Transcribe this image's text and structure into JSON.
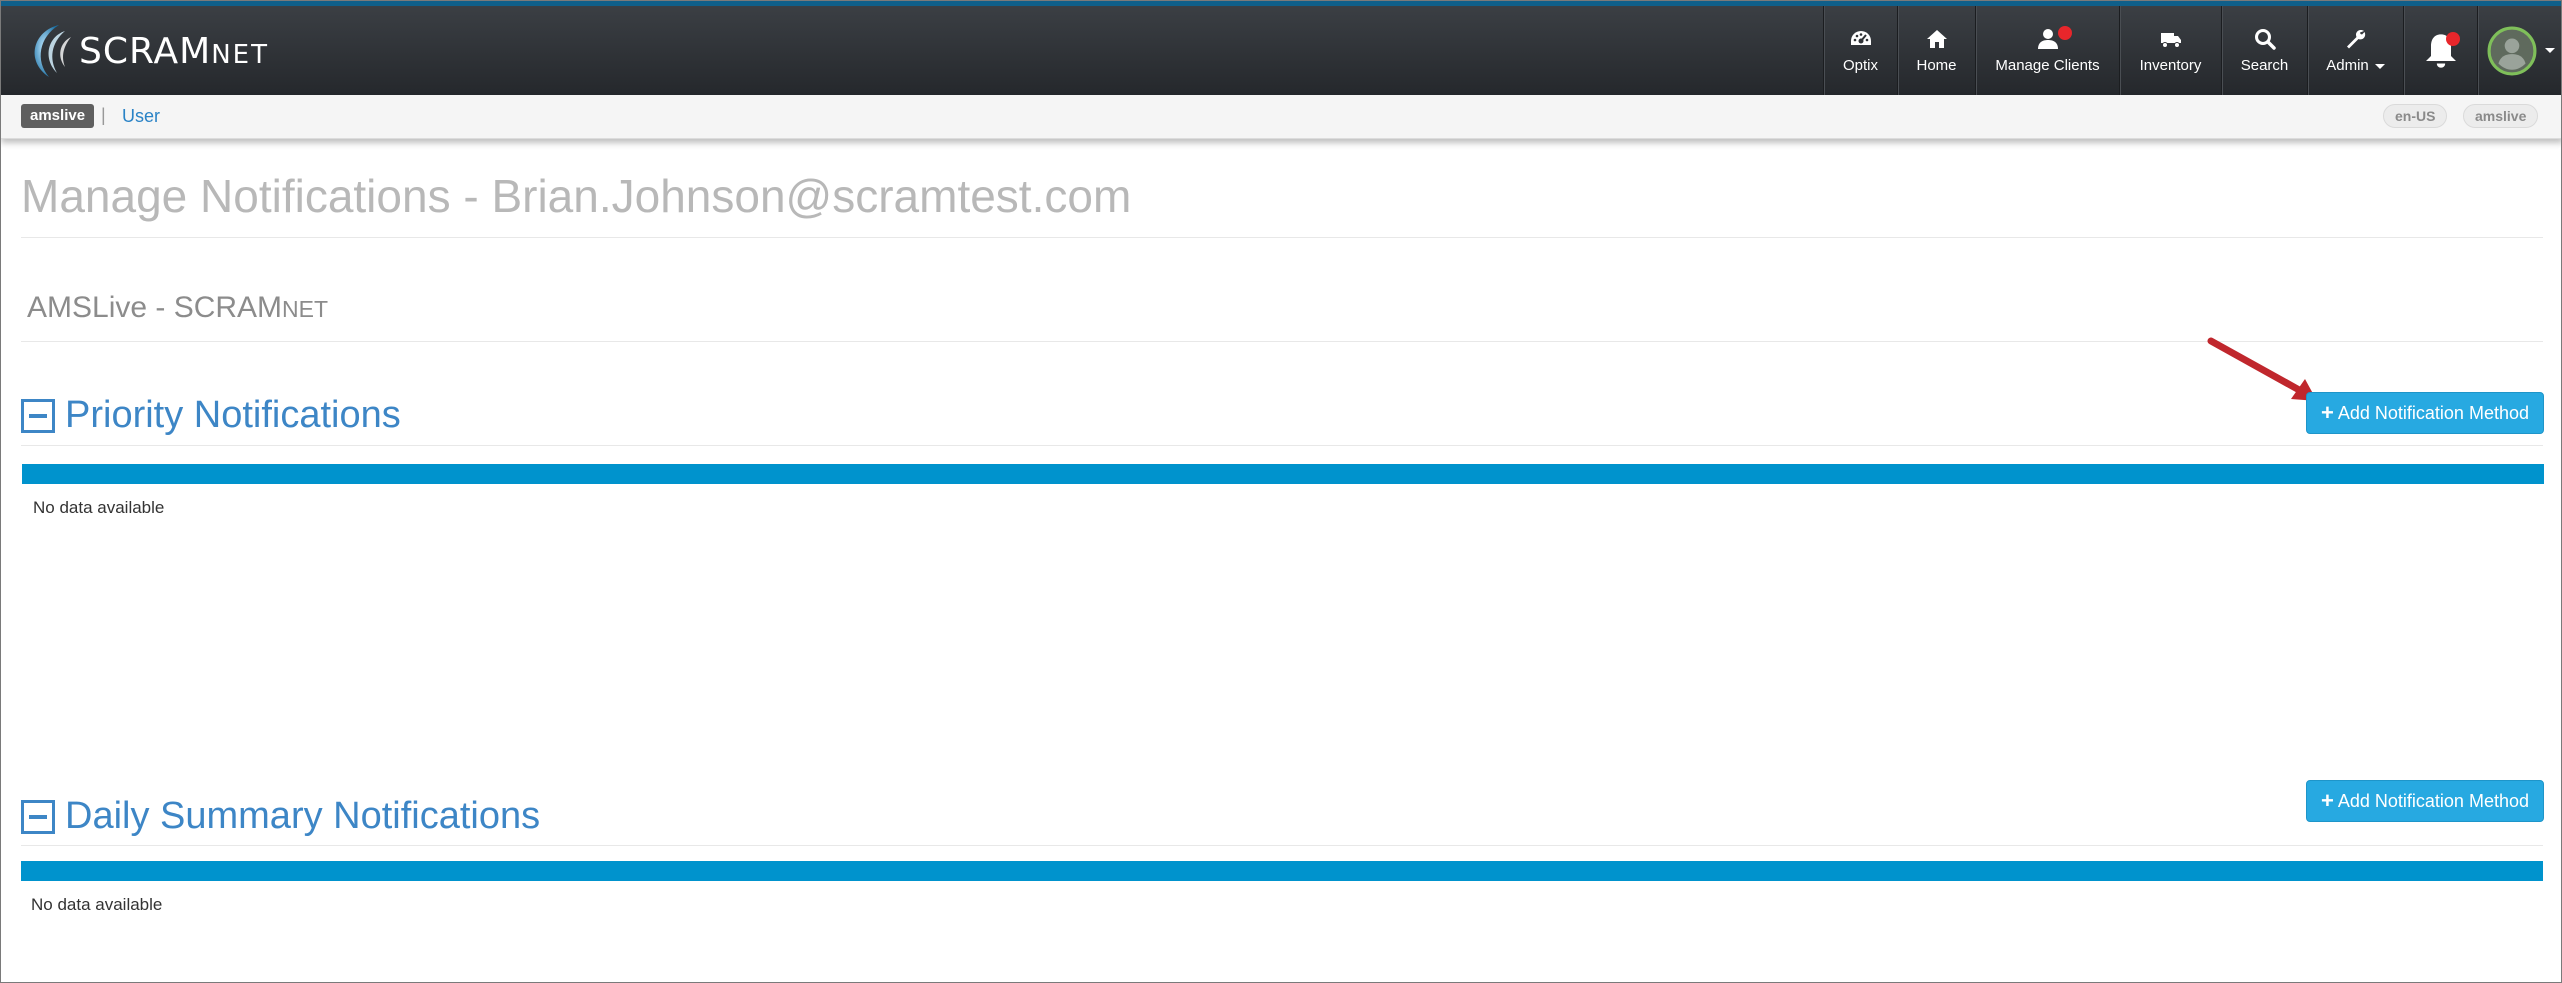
{
  "brand": {
    "name_main": "SCRAM",
    "name_suffix": "NET"
  },
  "nav": {
    "items": [
      {
        "label": "Optix",
        "icon": "dashboard-icon"
      },
      {
        "label": "Home",
        "icon": "home-icon"
      },
      {
        "label": "Manage Clients",
        "icon": "user-icon",
        "has_alert": true
      },
      {
        "label": "Inventory",
        "icon": "truck-icon"
      },
      {
        "label": "Search",
        "icon": "search-icon"
      },
      {
        "label": "Admin",
        "icon": "wrench-icon",
        "dropdown": true
      }
    ],
    "notifications_icon": "bell-icon",
    "avatar_icon": "user-avatar-icon"
  },
  "subbar": {
    "tenant": "amslive",
    "separator": "|",
    "user_link": "User",
    "locale": "en-US",
    "environment": "amslive"
  },
  "page": {
    "title": "Manage Notifications - Brian.Johnson@scramtest.com",
    "org_main": "AMSLive - SCRAM",
    "org_suffix": "NET"
  },
  "sections": {
    "priority": {
      "title": "Priority Notifications",
      "add_button": "Add Notification Method",
      "empty_text": "No data available"
    },
    "daily": {
      "title": "Daily Summary Notifications",
      "add_button": "Add Notification Method",
      "empty_text": "No data available"
    }
  },
  "colors": {
    "nav_bg": "#2f3236",
    "accent_blue": "#3d86c6",
    "button_blue": "#27a9e1",
    "table_header": "#0093cd",
    "alert_red": "#e8262b",
    "annotation_arrow": "#c0272d"
  }
}
